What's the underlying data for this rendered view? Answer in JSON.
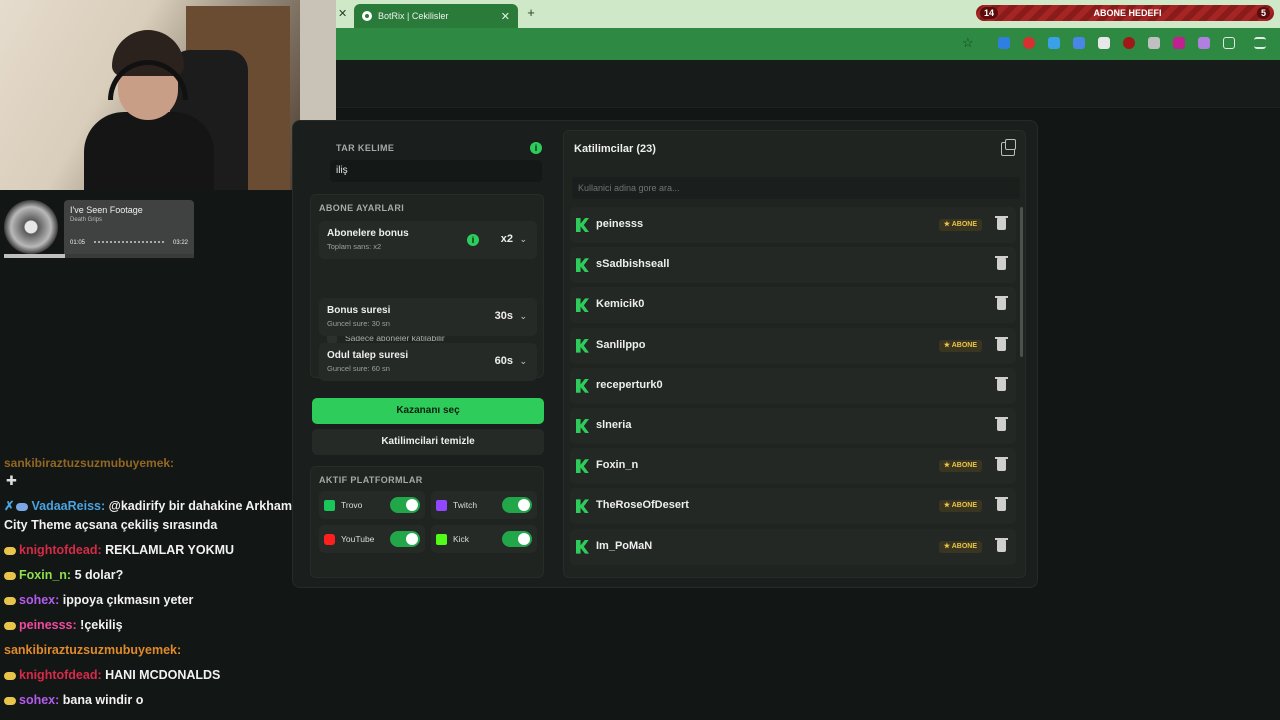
{
  "browser": {
    "tab_title": "BotRix | Cekilisler",
    "goal": {
      "left": "14",
      "label": "ABONE HEDEFI",
      "right": "5"
    }
  },
  "music": {
    "song": "I've Seen Footage",
    "artist": "Death Grips",
    "elapsed": "01:05",
    "total": "03:22",
    "progress": 0.32
  },
  "chat": {
    "cut_line": "sankibiraztuzsuzmubuyemek:",
    "messages": [
      {
        "user": "VadaaReiss:",
        "color": "#4aa3df",
        "text": "@kadirify bir dahakine Arkham City Theme açsana çekiliş sırasında",
        "mod": true
      },
      {
        "user": "knightofdead:",
        "color": "#d62b48",
        "text": "REKLAMLAR YOKMU",
        "mod": false
      },
      {
        "user": "Foxin_n:",
        "color": "#8fe04a",
        "text": "5 dolar?",
        "mod": false
      },
      {
        "user": "sohex:",
        "color": "#b45cf0",
        "text": "ippoya çıkmasın yeter",
        "mod": false
      },
      {
        "user": "peinesss:",
        "color": "#f04aa0",
        "text": "!çekiliş",
        "mod": false
      },
      {
        "user": "sankibiraztuzsuzmubuyemek:",
        "color": "#e08a2a",
        "text": "",
        "mod": false,
        "nobadge": true
      },
      {
        "user": "knightofdead:",
        "color": "#d62b48",
        "text": "HANI MCDONALDS",
        "mod": false
      },
      {
        "user": "sohex:",
        "color": "#b45cf0",
        "text": "bana windir o",
        "mod": false
      }
    ]
  },
  "keyword": {
    "label": "TAR KELIME",
    "value": "iliş"
  },
  "subscriber": {
    "label": "ABONE AYARLARI",
    "bonus_title": "Abonelere bonus",
    "bonus_sub": "Toplam sans: x2",
    "bonus_value": "x2",
    "only_subs": "Sadece aboneler katilabilir",
    "bonus_time_title": "Bonus suresi",
    "bonus_time_sub": "Guncel sure: 30 sn",
    "bonus_time_value": "30s",
    "claim_title": "Odul talep suresi",
    "claim_sub": "Guncel sure: 60 sn",
    "claim_value": "60s"
  },
  "buttons": {
    "pick": "Kazananı seç",
    "clear": "Katilimcilari temizle"
  },
  "platforms": {
    "label": "AKTIF PLATFORMLAR",
    "items": [
      {
        "name": "Trovo",
        "color": "#19c65c"
      },
      {
        "name": "Twitch",
        "color": "#9146ff"
      },
      {
        "name": "YouTube",
        "color": "#ff1f1f"
      },
      {
        "name": "Kick",
        "color": "#53fc18"
      }
    ]
  },
  "participants": {
    "title": "Katilimcilar (23)",
    "search_placeholder": "Kullanici adina gore ara...",
    "abone_label": "ABONE",
    "list": [
      {
        "name": "peinesss",
        "abone": true
      },
      {
        "name": "sSadbishseall",
        "abone": false
      },
      {
        "name": "Kemicik0",
        "abone": false
      },
      {
        "name": "Sanlilppo",
        "abone": true
      },
      {
        "name": "receperturk0",
        "abone": false
      },
      {
        "name": "slneria",
        "abone": false
      },
      {
        "name": "Foxin_n",
        "abone": true
      },
      {
        "name": "TheRoseOfDesert",
        "abone": true
      },
      {
        "name": "Im_PoMaN",
        "abone": true
      }
    ]
  }
}
